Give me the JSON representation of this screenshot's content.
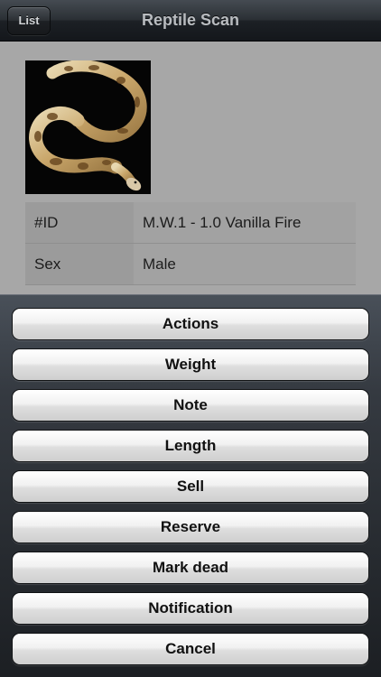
{
  "nav": {
    "title": "Reptile Scan",
    "back_label": "List"
  },
  "image": {
    "subject": "ball python on black background"
  },
  "info_rows": [
    {
      "key": "#ID",
      "value": "M.W.1 - 1.0 Vanilla Fire"
    },
    {
      "key": "Sex",
      "value": "Male"
    }
  ],
  "action_sheet": {
    "buttons": [
      "Actions",
      "Weight",
      "Note",
      "Length",
      "Sell",
      "Reserve",
      "Mark dead",
      "Notification",
      "Cancel"
    ]
  },
  "colors": {
    "navbar": "#2b3035",
    "background": "#a7a7a7",
    "sheet": "#2e333a",
    "button": "#e8e8e8"
  }
}
